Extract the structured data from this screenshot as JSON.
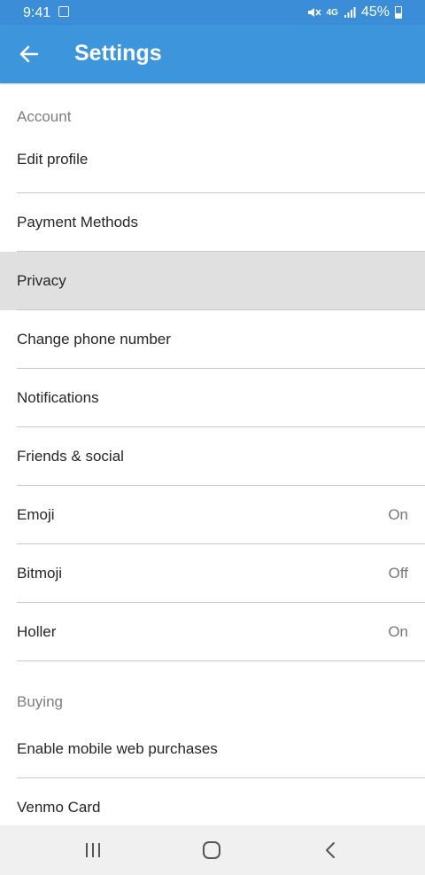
{
  "status_bar": {
    "time": "9:41",
    "network": "4G",
    "battery": "45%"
  },
  "app_bar": {
    "title": "Settings",
    "background": "#3d95dc"
  },
  "sections": [
    {
      "header": "Account",
      "items": [
        {
          "label": "Edit profile",
          "value": ""
        },
        {
          "label": "Payment Methods",
          "value": ""
        },
        {
          "label": "Privacy",
          "value": "",
          "highlighted": true
        },
        {
          "label": "Change phone number",
          "value": ""
        },
        {
          "label": "Notifications",
          "value": ""
        },
        {
          "label": "Friends & social",
          "value": ""
        },
        {
          "label": "Emoji",
          "value": "On"
        },
        {
          "label": "Bitmoji",
          "value": "Off"
        },
        {
          "label": "Holler",
          "value": "On"
        }
      ]
    },
    {
      "header": "Buying",
      "items": [
        {
          "label": "Enable mobile web purchases",
          "value": ""
        },
        {
          "label": "Venmo Card",
          "value": ""
        }
      ]
    }
  ],
  "nav_bar": {
    "icons": [
      "recent-apps-icon",
      "home-icon",
      "back-icon"
    ]
  }
}
